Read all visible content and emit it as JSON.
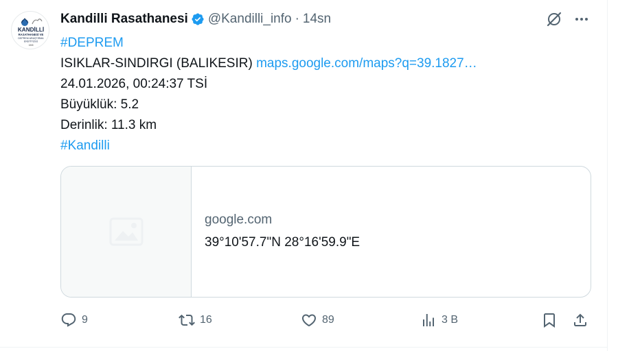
{
  "tweet": {
    "author_name": "Kandilli Rasathanesi",
    "handle": "@Kandilli_info",
    "separator": "·",
    "time": "14sn",
    "lines": {
      "hashtag_deprem": "#DEPREM",
      "location": "ISIKLAR-SINDIRGI (BALIKESIR)",
      "map_link": "maps.google.com/maps?q=39.1827…",
      "datetime": "24.01.2026, 00:24:37 TSİ",
      "magnitude": "Büyüklük: 5.2",
      "depth": "Derinlik: 11.3 km",
      "hashtag_kandilli": "#Kandilli"
    }
  },
  "avatar": {
    "logo_lines": [
      "KANDİLLİ",
      "RASATHANESİ VE",
      "DEPREM ARAŞTIRMA",
      "ENSTİTÜSÜ",
      "1868"
    ]
  },
  "card": {
    "domain": "google.com",
    "title": "39°10'57.7\"N 28°16'59.9\"E"
  },
  "actions": {
    "replies": "9",
    "reposts": "16",
    "likes": "89",
    "views": "3 B"
  },
  "colors": {
    "accent": "#1d9bf0",
    "text": "#0f1419",
    "secondary": "#536471",
    "border": "#cfd9de"
  },
  "icons": [
    "verified-badge-icon",
    "grok-icon",
    "more-icon",
    "reply-icon",
    "repost-icon",
    "like-icon",
    "views-icon",
    "bookmark-icon",
    "share-icon",
    "link-card-icon"
  ]
}
